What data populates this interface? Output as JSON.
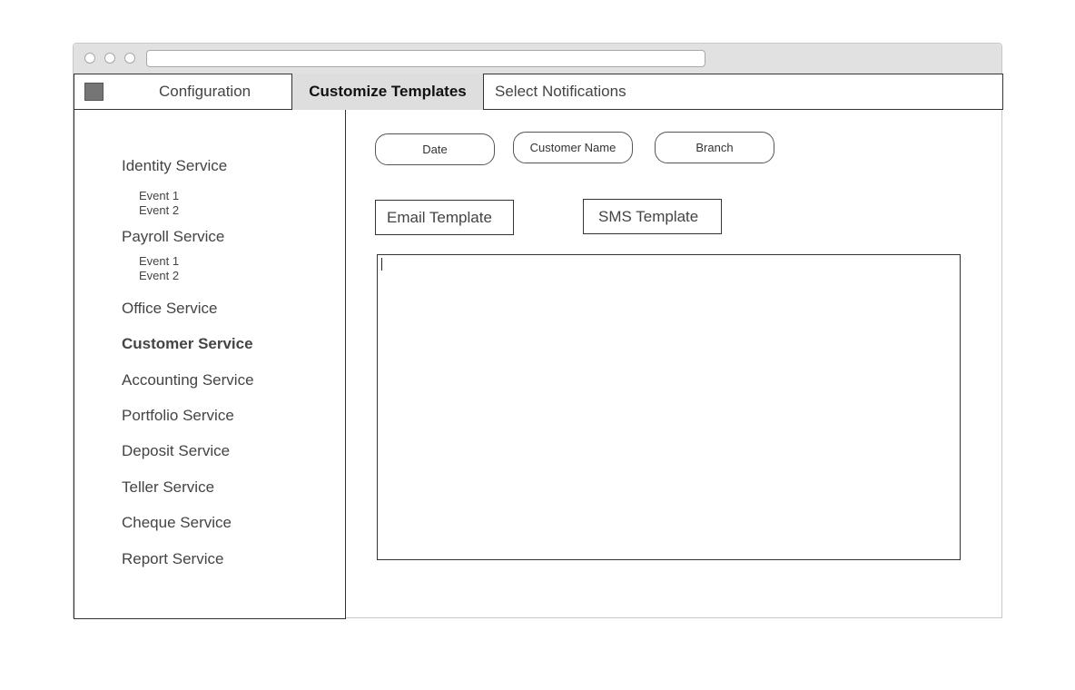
{
  "tabs": {
    "configuration": "Configuration",
    "customize_templates": "Customize Templates",
    "select_notifications": "Select Notifications",
    "active": "Customize Templates"
  },
  "sidebar": {
    "services": [
      {
        "label": "Identity Service",
        "events": [
          "Event 1",
          "Event 2"
        ]
      },
      {
        "label": "Payroll Service",
        "events": [
          "Event 1",
          "Event 2"
        ]
      },
      {
        "label": "Office Service"
      },
      {
        "label": "Customer Service",
        "selected": true
      },
      {
        "label": "Accounting Service"
      },
      {
        "label": "Portfolio Service"
      },
      {
        "label": "Deposit Service"
      },
      {
        "label": "Teller Service"
      },
      {
        "label": "Cheque Service"
      },
      {
        "label": "Report Service"
      }
    ]
  },
  "placeholders": {
    "date": "Date",
    "customer_name": "Customer Name",
    "branch": "Branch"
  },
  "template_buttons": {
    "email": "Email Template",
    "sms": "SMS Template"
  },
  "editor": {
    "value": ""
  },
  "colors": {
    "active_tab_bg": "#dedede",
    "border": "#333333",
    "titlebar": "#e1e1e1",
    "app_icon": "#757575"
  }
}
